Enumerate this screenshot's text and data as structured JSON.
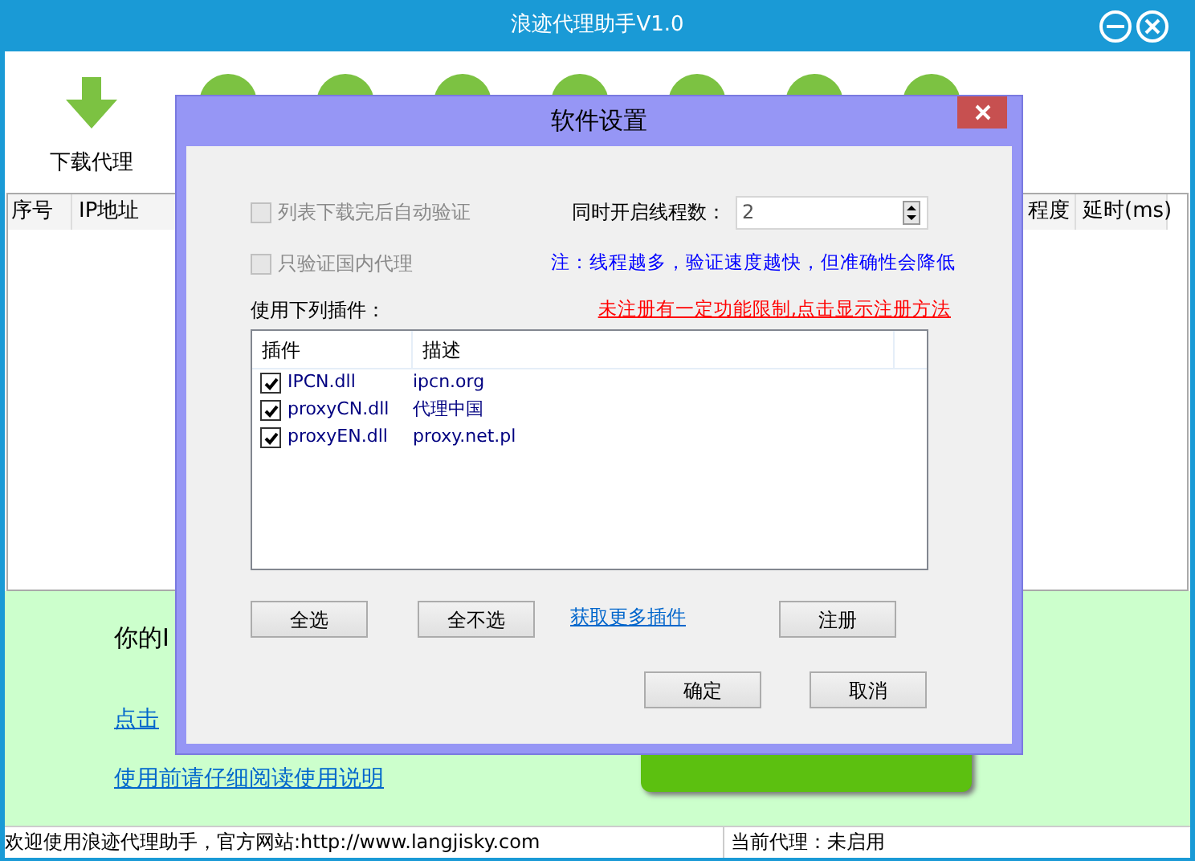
{
  "window": {
    "title": "浪迹代理助手V1.0"
  },
  "toolbar": {
    "items": [
      {
        "label": "下载代理"
      }
    ]
  },
  "table": {
    "columns": [
      {
        "label": "序号"
      },
      {
        "label": "IP地址"
      },
      {
        "label": "程度"
      },
      {
        "label": "延时(ms)"
      }
    ]
  },
  "info": {
    "text": "你的I",
    "link": "点击",
    "manual_link": "使用前请仔细阅读使用说明"
  },
  "status_bar": {
    "welcome": "欢迎使用浪迹代理助手，官方网站:http://www.langjisky.com",
    "proxy": "当前代理：未启用"
  },
  "dialog": {
    "title": "软件设置",
    "options": [
      {
        "label": "列表下载完后自动验证",
        "checked": false,
        "disabled": true
      },
      {
        "label": "只验证国内代理",
        "checked": false,
        "disabled": true
      }
    ],
    "threads": {
      "label": "同时开启线程数：",
      "value": "2"
    },
    "note": "注：线程越多，验证速度越快，但准确性会降低",
    "plugins_label": "使用下列插件：",
    "register_link": "未注册有一定功能限制,点击显示注册方法",
    "plugin_columns": [
      "插件",
      "描述"
    ],
    "plugins": [
      {
        "name": "IPCN.dll",
        "description": "ipcn.org",
        "checked": true
      },
      {
        "name": "proxyCN.dll",
        "description": "代理中国",
        "checked": true
      },
      {
        "name": "proxyEN.dll",
        "description": "proxy.net.pl",
        "checked": true
      }
    ],
    "select_all": "全选",
    "select_none": "全不选",
    "more_plugins": "获取更多插件",
    "register": "注册",
    "ok": "确定",
    "cancel": "取消"
  }
}
